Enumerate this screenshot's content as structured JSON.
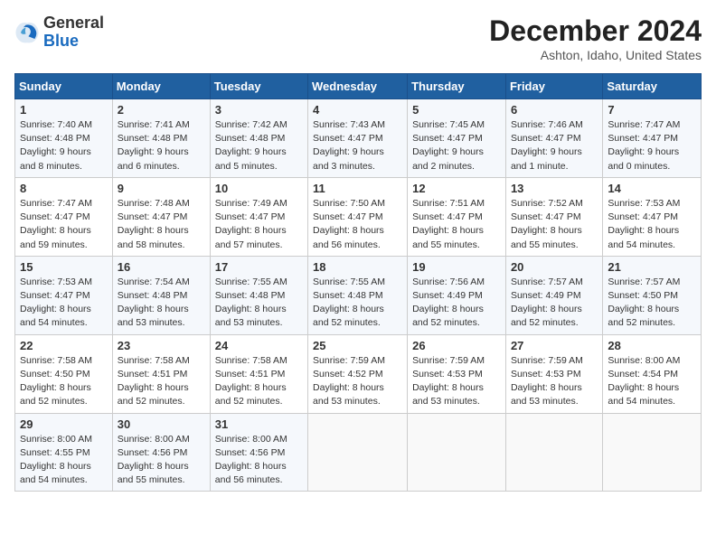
{
  "header": {
    "logo_general": "General",
    "logo_blue": "Blue",
    "month_title": "December 2024",
    "location": "Ashton, Idaho, United States"
  },
  "days_of_week": [
    "Sunday",
    "Monday",
    "Tuesday",
    "Wednesday",
    "Thursday",
    "Friday",
    "Saturday"
  ],
  "weeks": [
    [
      {
        "day": 1,
        "sunrise": "7:40 AM",
        "sunset": "4:48 PM",
        "daylight": "9 hours and 8 minutes."
      },
      {
        "day": 2,
        "sunrise": "7:41 AM",
        "sunset": "4:48 PM",
        "daylight": "9 hours and 6 minutes."
      },
      {
        "day": 3,
        "sunrise": "7:42 AM",
        "sunset": "4:48 PM",
        "daylight": "9 hours and 5 minutes."
      },
      {
        "day": 4,
        "sunrise": "7:43 AM",
        "sunset": "4:47 PM",
        "daylight": "9 hours and 3 minutes."
      },
      {
        "day": 5,
        "sunrise": "7:45 AM",
        "sunset": "4:47 PM",
        "daylight": "9 hours and 2 minutes."
      },
      {
        "day": 6,
        "sunrise": "7:46 AM",
        "sunset": "4:47 PM",
        "daylight": "9 hours and 1 minute."
      },
      {
        "day": 7,
        "sunrise": "7:47 AM",
        "sunset": "4:47 PM",
        "daylight": "9 hours and 0 minutes."
      }
    ],
    [
      {
        "day": 8,
        "sunrise": "7:47 AM",
        "sunset": "4:47 PM",
        "daylight": "8 hours and 59 minutes."
      },
      {
        "day": 9,
        "sunrise": "7:48 AM",
        "sunset": "4:47 PM",
        "daylight": "8 hours and 58 minutes."
      },
      {
        "day": 10,
        "sunrise": "7:49 AM",
        "sunset": "4:47 PM",
        "daylight": "8 hours and 57 minutes."
      },
      {
        "day": 11,
        "sunrise": "7:50 AM",
        "sunset": "4:47 PM",
        "daylight": "8 hours and 56 minutes."
      },
      {
        "day": 12,
        "sunrise": "7:51 AM",
        "sunset": "4:47 PM",
        "daylight": "8 hours and 55 minutes."
      },
      {
        "day": 13,
        "sunrise": "7:52 AM",
        "sunset": "4:47 PM",
        "daylight": "8 hours and 55 minutes."
      },
      {
        "day": 14,
        "sunrise": "7:53 AM",
        "sunset": "4:47 PM",
        "daylight": "8 hours and 54 minutes."
      }
    ],
    [
      {
        "day": 15,
        "sunrise": "7:53 AM",
        "sunset": "4:47 PM",
        "daylight": "8 hours and 54 minutes."
      },
      {
        "day": 16,
        "sunrise": "7:54 AM",
        "sunset": "4:48 PM",
        "daylight": "8 hours and 53 minutes."
      },
      {
        "day": 17,
        "sunrise": "7:55 AM",
        "sunset": "4:48 PM",
        "daylight": "8 hours and 53 minutes."
      },
      {
        "day": 18,
        "sunrise": "7:55 AM",
        "sunset": "4:48 PM",
        "daylight": "8 hours and 52 minutes."
      },
      {
        "day": 19,
        "sunrise": "7:56 AM",
        "sunset": "4:49 PM",
        "daylight": "8 hours and 52 minutes."
      },
      {
        "day": 20,
        "sunrise": "7:57 AM",
        "sunset": "4:49 PM",
        "daylight": "8 hours and 52 minutes."
      },
      {
        "day": 21,
        "sunrise": "7:57 AM",
        "sunset": "4:50 PM",
        "daylight": "8 hours and 52 minutes."
      }
    ],
    [
      {
        "day": 22,
        "sunrise": "7:58 AM",
        "sunset": "4:50 PM",
        "daylight": "8 hours and 52 minutes."
      },
      {
        "day": 23,
        "sunrise": "7:58 AM",
        "sunset": "4:51 PM",
        "daylight": "8 hours and 52 minutes."
      },
      {
        "day": 24,
        "sunrise": "7:58 AM",
        "sunset": "4:51 PM",
        "daylight": "8 hours and 52 minutes."
      },
      {
        "day": 25,
        "sunrise": "7:59 AM",
        "sunset": "4:52 PM",
        "daylight": "8 hours and 53 minutes."
      },
      {
        "day": 26,
        "sunrise": "7:59 AM",
        "sunset": "4:53 PM",
        "daylight": "8 hours and 53 minutes."
      },
      {
        "day": 27,
        "sunrise": "7:59 AM",
        "sunset": "4:53 PM",
        "daylight": "8 hours and 53 minutes."
      },
      {
        "day": 28,
        "sunrise": "8:00 AM",
        "sunset": "4:54 PM",
        "daylight": "8 hours and 54 minutes."
      }
    ],
    [
      {
        "day": 29,
        "sunrise": "8:00 AM",
        "sunset": "4:55 PM",
        "daylight": "8 hours and 54 minutes."
      },
      {
        "day": 30,
        "sunrise": "8:00 AM",
        "sunset": "4:56 PM",
        "daylight": "8 hours and 55 minutes."
      },
      {
        "day": 31,
        "sunrise": "8:00 AM",
        "sunset": "4:56 PM",
        "daylight": "8 hours and 56 minutes."
      },
      null,
      null,
      null,
      null
    ]
  ]
}
